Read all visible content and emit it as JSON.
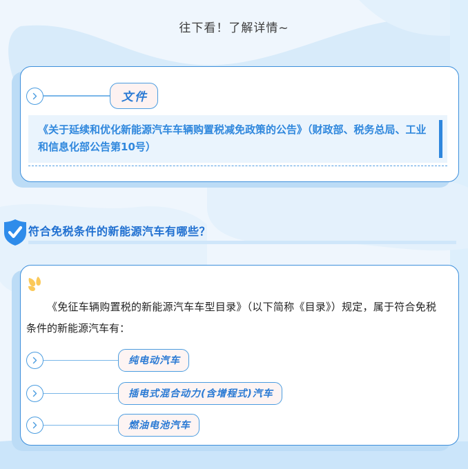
{
  "header": {
    "headline": "往下看！了解详情~"
  },
  "colors": {
    "page_background": "#eff6fd",
    "accent_blue": "#2f87dd",
    "card_border": "#3d8fdb",
    "card_backing": "#bcdcf6",
    "pill_background": "#fdf4f3",
    "doc_block_background": "#eaf4fd",
    "heading_blue": "#1f6fd0",
    "sparkle_yellow": "#fbc95a",
    "shield_blue": "#2f8cea",
    "rule_blue": "#cfe6fa"
  },
  "document_card": {
    "badge_label": "文件",
    "badge_icon": "chevron-right-circle-icon",
    "title": "《关于延续和优化新能源汽车车辆购置税减免政策的公告》（财政部、税务总局、工业和信息化部公告第10号）"
  },
  "section": {
    "icon": "shield-check-icon",
    "title": "符合免税条件的新能源汽车有哪些？"
  },
  "answer_card": {
    "decor_icon": "sparkle-quote-icon",
    "paragraph": "《免征车辆购置税的新能源汽车车型目录》（以下简称《目录》）规定，属于符合免税条件的新能源汽车有：",
    "vehicle_types": [
      {
        "icon": "chevron-right-circle-icon",
        "label": "纯电动汽车"
      },
      {
        "icon": "chevron-right-circle-icon",
        "label": "插电式混合动力(含增程式)汽车"
      },
      {
        "icon": "chevron-right-circle-icon",
        "label": "燃油电池汽车"
      }
    ]
  }
}
